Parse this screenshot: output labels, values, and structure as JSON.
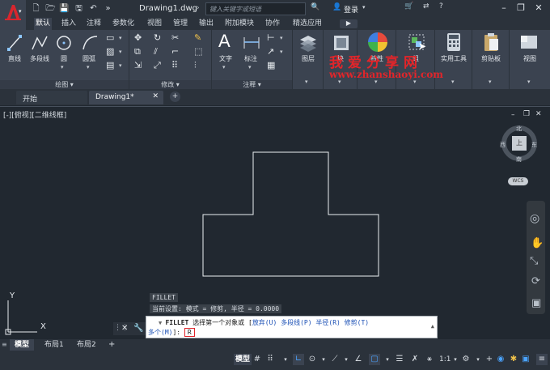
{
  "app": {
    "title": "Drawing1.dwg",
    "search_placeholder": "键入关键字或短语",
    "login": "登录",
    "brand_color": "#d8262e"
  },
  "ribbon_tabs": [
    "默认",
    "插入",
    "注释",
    "参数化",
    "视图",
    "管理",
    "输出",
    "附加模块",
    "协作",
    "精选应用"
  ],
  "ribbon_active_tab": "默认",
  "draw_panel": {
    "buttons": [
      "直线",
      "多段线",
      "圆",
      "圆弧"
    ],
    "label": "绘图"
  },
  "modify_panel": {
    "label": "修改"
  },
  "annotation_panel": {
    "buttons": [
      "文字",
      "标注"
    ],
    "label": "注释"
  },
  "big_buttons": [
    "图层",
    "块",
    "特性",
    "组",
    "实用工具",
    "剪贴板",
    "视图"
  ],
  "watermark": {
    "line1": "我爱分享网",
    "line2": "www.zhanshaoyi.com"
  },
  "file_tabs": [
    "开始",
    "Drawing1*"
  ],
  "viewport_label": "[-][俯视][二维线框]",
  "viewcube": {
    "north": "北",
    "south": "南",
    "east": "东",
    "west": "西",
    "center": "上",
    "wcs": "WCS"
  },
  "ucs": {
    "x": "X",
    "y": "Y"
  },
  "command": {
    "history1": "FILLET",
    "history2": "当前设置: 模式 = 修剪, 半径 = 0.0000",
    "prompt_cmd": "FILLET",
    "prompt_text": "选择第一个对象或 [",
    "options": [
      "放弃(U)",
      "多段线(P)",
      "半径(R)",
      "修剪(T)",
      "多个(M)"
    ],
    "prompt_end": "]:",
    "input_value": "R"
  },
  "layout_tabs": [
    "模型",
    "布局1",
    "布局2"
  ],
  "status": {
    "model": "模型",
    "scale": "1:1"
  }
}
